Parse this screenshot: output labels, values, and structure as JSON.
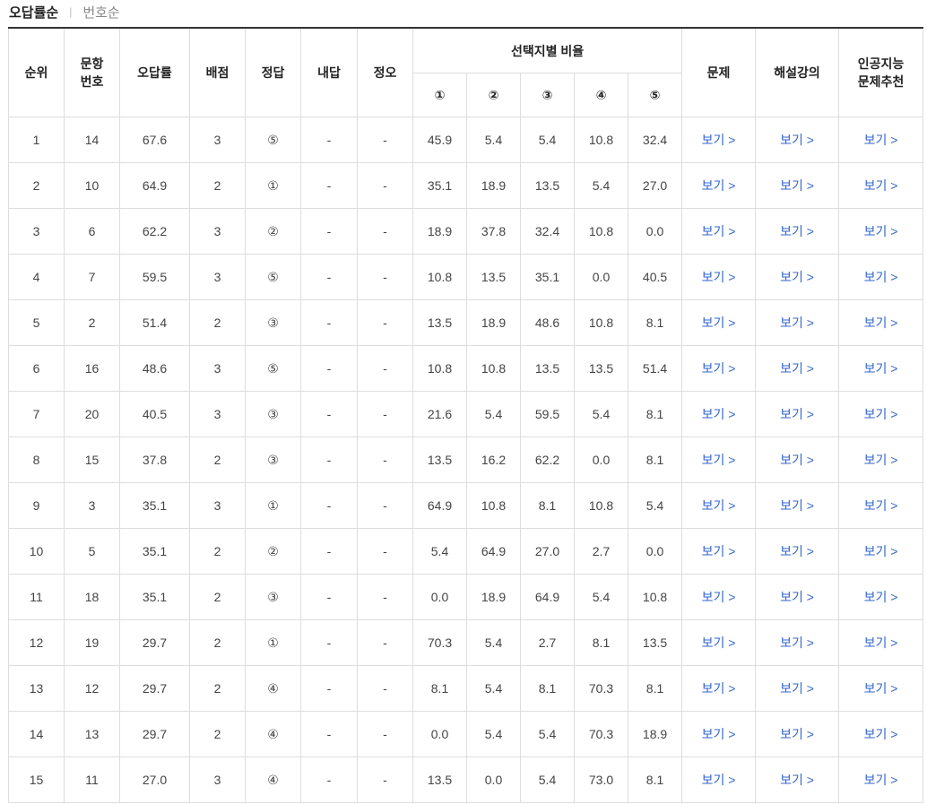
{
  "sort_tabs": {
    "active_label": "오답률순",
    "separator": "|",
    "inactive_label": "번호순"
  },
  "headers": {
    "rank": "순위",
    "q_no_line1": "문항",
    "q_no_line2": "번호",
    "error_rate": "오답률",
    "points": "배점",
    "answer": "정답",
    "my_answer": "내답",
    "correctness": "정오",
    "choice_ratio": "선택지별 비율",
    "choices": [
      "①",
      "②",
      "③",
      "④",
      "⑤"
    ],
    "problem": "문제",
    "lecture": "해설강의",
    "ai_line1": "인공지능",
    "ai_line2": "문제추천"
  },
  "link_label": "보기 >",
  "rows": [
    {
      "rank": "1",
      "no": "14",
      "rate": "67.6",
      "pts": "3",
      "ans": "⑤",
      "my": "-",
      "ox": "-",
      "c": [
        "45.9",
        "5.4",
        "5.4",
        "10.8",
        "32.4"
      ]
    },
    {
      "rank": "2",
      "no": "10",
      "rate": "64.9",
      "pts": "2",
      "ans": "①",
      "my": "-",
      "ox": "-",
      "c": [
        "35.1",
        "18.9",
        "13.5",
        "5.4",
        "27.0"
      ]
    },
    {
      "rank": "3",
      "no": "6",
      "rate": "62.2",
      "pts": "3",
      "ans": "②",
      "my": "-",
      "ox": "-",
      "c": [
        "18.9",
        "37.8",
        "32.4",
        "10.8",
        "0.0"
      ]
    },
    {
      "rank": "4",
      "no": "7",
      "rate": "59.5",
      "pts": "3",
      "ans": "⑤",
      "my": "-",
      "ox": "-",
      "c": [
        "10.8",
        "13.5",
        "35.1",
        "0.0",
        "40.5"
      ]
    },
    {
      "rank": "5",
      "no": "2",
      "rate": "51.4",
      "pts": "2",
      "ans": "③",
      "my": "-",
      "ox": "-",
      "c": [
        "13.5",
        "18.9",
        "48.6",
        "10.8",
        "8.1"
      ]
    },
    {
      "rank": "6",
      "no": "16",
      "rate": "48.6",
      "pts": "3",
      "ans": "⑤",
      "my": "-",
      "ox": "-",
      "c": [
        "10.8",
        "10.8",
        "13.5",
        "13.5",
        "51.4"
      ]
    },
    {
      "rank": "7",
      "no": "20",
      "rate": "40.5",
      "pts": "3",
      "ans": "③",
      "my": "-",
      "ox": "-",
      "c": [
        "21.6",
        "5.4",
        "59.5",
        "5.4",
        "8.1"
      ]
    },
    {
      "rank": "8",
      "no": "15",
      "rate": "37.8",
      "pts": "2",
      "ans": "③",
      "my": "-",
      "ox": "-",
      "c": [
        "13.5",
        "16.2",
        "62.2",
        "0.0",
        "8.1"
      ]
    },
    {
      "rank": "9",
      "no": "3",
      "rate": "35.1",
      "pts": "3",
      "ans": "①",
      "my": "-",
      "ox": "-",
      "c": [
        "64.9",
        "10.8",
        "8.1",
        "10.8",
        "5.4"
      ]
    },
    {
      "rank": "10",
      "no": "5",
      "rate": "35.1",
      "pts": "2",
      "ans": "②",
      "my": "-",
      "ox": "-",
      "c": [
        "5.4",
        "64.9",
        "27.0",
        "2.7",
        "0.0"
      ]
    },
    {
      "rank": "11",
      "no": "18",
      "rate": "35.1",
      "pts": "2",
      "ans": "③",
      "my": "-",
      "ox": "-",
      "c": [
        "0.0",
        "18.9",
        "64.9",
        "5.4",
        "10.8"
      ]
    },
    {
      "rank": "12",
      "no": "19",
      "rate": "29.7",
      "pts": "2",
      "ans": "①",
      "my": "-",
      "ox": "-",
      "c": [
        "70.3",
        "5.4",
        "2.7",
        "8.1",
        "13.5"
      ]
    },
    {
      "rank": "13",
      "no": "12",
      "rate": "29.7",
      "pts": "2",
      "ans": "④",
      "my": "-",
      "ox": "-",
      "c": [
        "8.1",
        "5.4",
        "8.1",
        "70.3",
        "8.1"
      ]
    },
    {
      "rank": "14",
      "no": "13",
      "rate": "29.7",
      "pts": "2",
      "ans": "④",
      "my": "-",
      "ox": "-",
      "c": [
        "0.0",
        "5.4",
        "5.4",
        "70.3",
        "18.9"
      ]
    },
    {
      "rank": "15",
      "no": "11",
      "rate": "27.0",
      "pts": "3",
      "ans": "④",
      "my": "-",
      "ox": "-",
      "c": [
        "13.5",
        "0.0",
        "5.4",
        "73.0",
        "8.1"
      ]
    }
  ]
}
